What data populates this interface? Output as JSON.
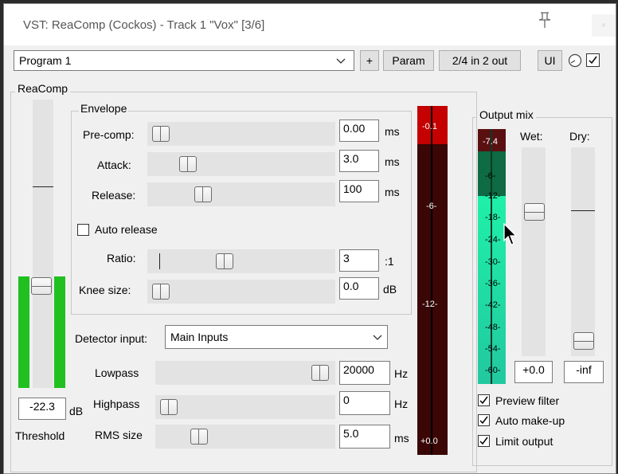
{
  "title": "VST: ReaComp (Cockos) - Track 1 \"Vox\" [3/6]",
  "toolbar": {
    "program": "Program 1",
    "plus_label": "+",
    "param_label": "Param",
    "io_label": "2/4 in 2 out",
    "ui_label": "UI",
    "close_label": "×"
  },
  "plugin_name": "ReaComp",
  "threshold": {
    "label": "Threshold",
    "value": "-22.3",
    "unit": "dB"
  },
  "envelope": {
    "title": "Envelope",
    "precomp": {
      "label": "Pre-comp:",
      "value": "0.00",
      "unit": "ms"
    },
    "attack": {
      "label": "Attack:",
      "value": "3.0",
      "unit": "ms"
    },
    "release": {
      "label": "Release:",
      "value": "100",
      "unit": "ms"
    },
    "auto_release": "Auto release",
    "ratio": {
      "label": "Ratio:",
      "value": "3",
      "unit": ":1"
    },
    "knee": {
      "label": "Knee size:",
      "value": "0.0",
      "unit": "dB"
    }
  },
  "detector": {
    "label": "Detector input:",
    "value": "Main Inputs"
  },
  "lowpass": {
    "label": "Lowpass",
    "value": "20000",
    "unit": "Hz"
  },
  "highpass": {
    "label": "Highpass",
    "value": "0",
    "unit": "Hz"
  },
  "rms": {
    "label": "RMS size",
    "value": "5.0",
    "unit": "ms"
  },
  "gr_meter": {
    "ticks": [
      "-0.1",
      "-6-",
      "-12-",
      "+0.0"
    ]
  },
  "output_mix": {
    "title": "Output mix",
    "wet_label": "Wet:",
    "dry_label": "Dry:",
    "wet_value": "+0.0",
    "dry_value": "-inf",
    "peak": "-7.4",
    "scale": [
      "-6-",
      "-12-",
      "-18-",
      "-24-",
      "-30-",
      "-36-",
      "-42-",
      "-48-",
      "-54-",
      "-60-"
    ]
  },
  "options": {
    "preview_filter": "Preview filter",
    "auto_makeup": "Auto make-up",
    "limit_output": "Limit output"
  }
}
